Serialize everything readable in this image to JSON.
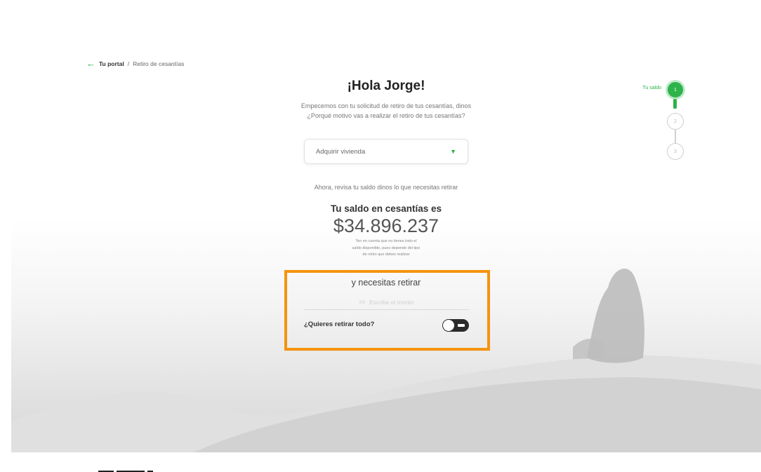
{
  "breadcrumb": {
    "portal": "Tu portal",
    "separator": "/",
    "current": "Retiro de cesantías"
  },
  "greeting": "¡Hola Jorge!",
  "intro": {
    "line1": "Empecemos con tu solicitud de retiro de tus cesantías, dinos",
    "line2": "¿Porqué motivo vas a realizar el retiro de tus cesantías?"
  },
  "reason_select": {
    "value": "Adquirir vivienda",
    "chevron": "▼"
  },
  "review_text": "Ahora, revisa tu saldo dinos lo que necesitas retirar",
  "balance": {
    "label": "Tu saldo en cesantías es",
    "amount": "$34.896.237",
    "note1": "Ten en cuenta que no tienes todo el",
    "note2": "saldo disponible, pues depende del tipo",
    "note3": "de retiro que debes realizar"
  },
  "withdraw": {
    "title": "y necesitas retirar",
    "amount_placeholder": "Escribe el monto",
    "withdraw_all_label": "¿Quieres retirar todo?",
    "withdraw_all": false
  },
  "steps": {
    "current_label": "Tu saldo",
    "items": [
      "1",
      "2",
      "3"
    ],
    "active_step": 1
  },
  "colors": {
    "brand_green": "#2db34a",
    "highlight_orange": "#f5940f",
    "toggle_dark": "#2b2b2b"
  },
  "icons": {
    "back": "arrow-left-icon",
    "chevron": "chevron-down-icon",
    "amount": "money-icon"
  }
}
